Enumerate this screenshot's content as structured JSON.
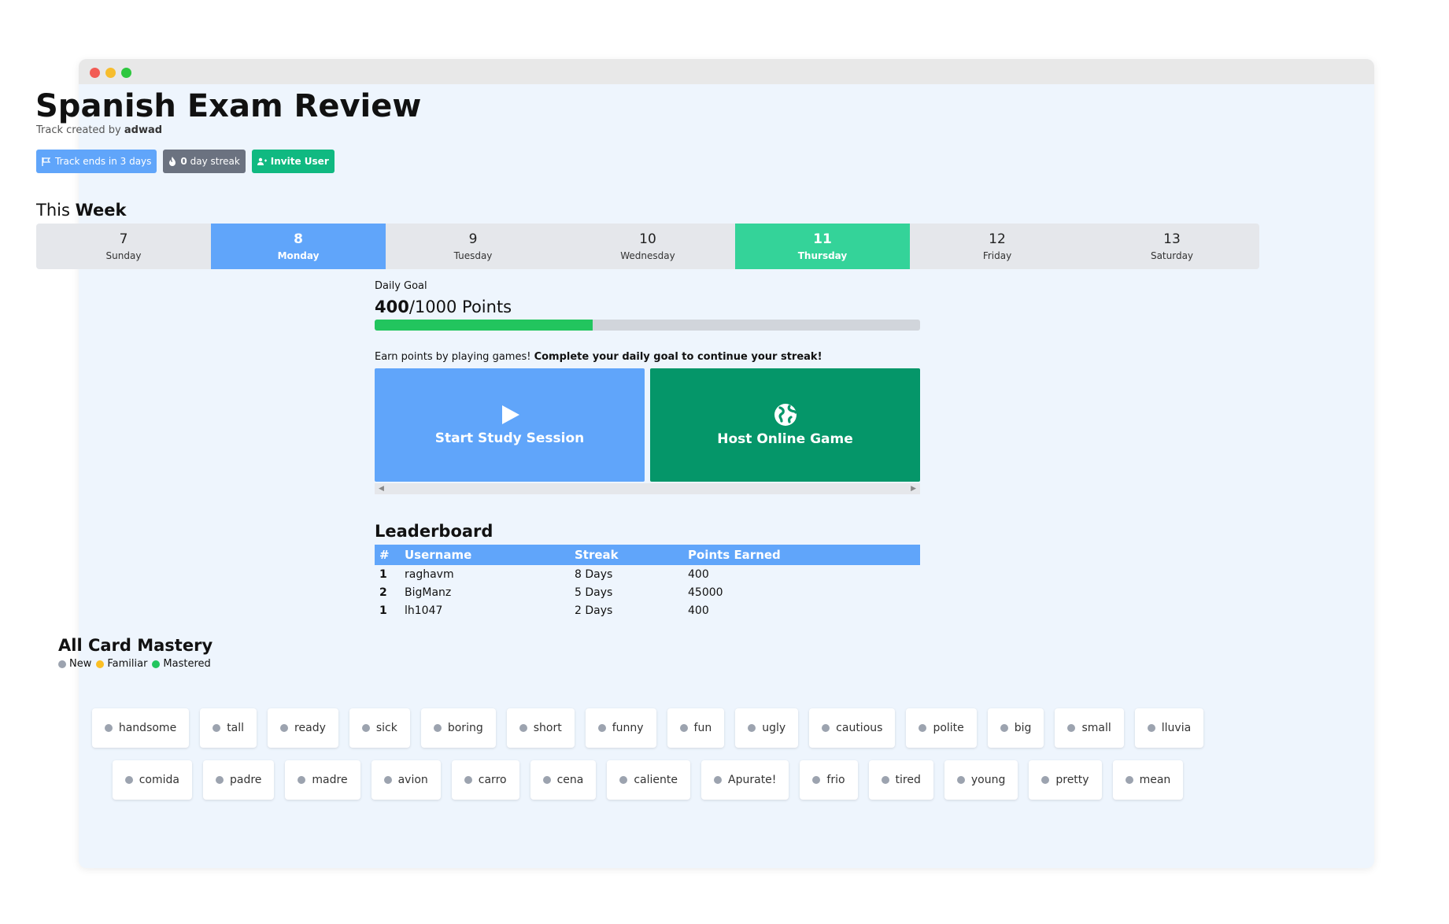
{
  "track": {
    "title": "Spanish Exam Review",
    "created_by_prefix": "Track created by ",
    "created_by_user": "adwad"
  },
  "badges": {
    "track_ends": "Track ends in 3 days",
    "streak_count": "0",
    "streak_suffix": " day streak",
    "invite": "Invite User"
  },
  "week": {
    "label_prefix": "This ",
    "label_bold": "Week",
    "days": [
      {
        "num": "7",
        "name": "Sunday"
      },
      {
        "num": "8",
        "name": "Monday"
      },
      {
        "num": "9",
        "name": "Tuesday"
      },
      {
        "num": "10",
        "name": "Wednesday"
      },
      {
        "num": "11",
        "name": "Thursday"
      },
      {
        "num": "12",
        "name": "Friday"
      },
      {
        "num": "13",
        "name": "Saturday"
      }
    ],
    "current_day_index": 1,
    "today_index": 4
  },
  "daily_goal": {
    "label": "Daily Goal",
    "current": "400",
    "target_text": "/1000 Points",
    "progress_fraction": 0.4
  },
  "earn": {
    "text": "Earn points by playing games! ",
    "bold": "Complete your daily goal to continue your streak!"
  },
  "actions": {
    "study": "Start Study Session",
    "host": "Host Online Game"
  },
  "leaderboard": {
    "title": "Leaderboard",
    "headers": [
      "#",
      "Username",
      "Streak",
      "Points Earned"
    ],
    "rows": [
      {
        "rank": "1",
        "username": "raghavm",
        "streak": "8 Days",
        "points": "400"
      },
      {
        "rank": "2",
        "username": "BigManz",
        "streak": "5 Days",
        "points": "45000"
      },
      {
        "rank": "1",
        "username": "lh1047",
        "streak": "2 Days",
        "points": "400"
      }
    ]
  },
  "mastery": {
    "title": "All Card Mastery",
    "legend": [
      {
        "label": "New",
        "color": "#9ca3af"
      },
      {
        "label": "Familiar",
        "color": "#fbbf24"
      },
      {
        "label": "Mastered",
        "color": "#22c55e"
      }
    ],
    "row1": [
      "handsome",
      "tall",
      "ready",
      "sick",
      "boring",
      "short",
      "funny",
      "fun",
      "ugly",
      "cautious",
      "polite",
      "big",
      "small",
      "lluvia"
    ],
    "row2": [
      "comida",
      "padre",
      "madre",
      "avion",
      "carro",
      "cena",
      "caliente",
      "Apurate!",
      "frio",
      "tired",
      "young",
      "pretty",
      "mean"
    ]
  },
  "colors": {
    "blue": "#60a5fa",
    "green": "#34d399",
    "dark_green": "#059669",
    "progress": "#22c55e"
  }
}
